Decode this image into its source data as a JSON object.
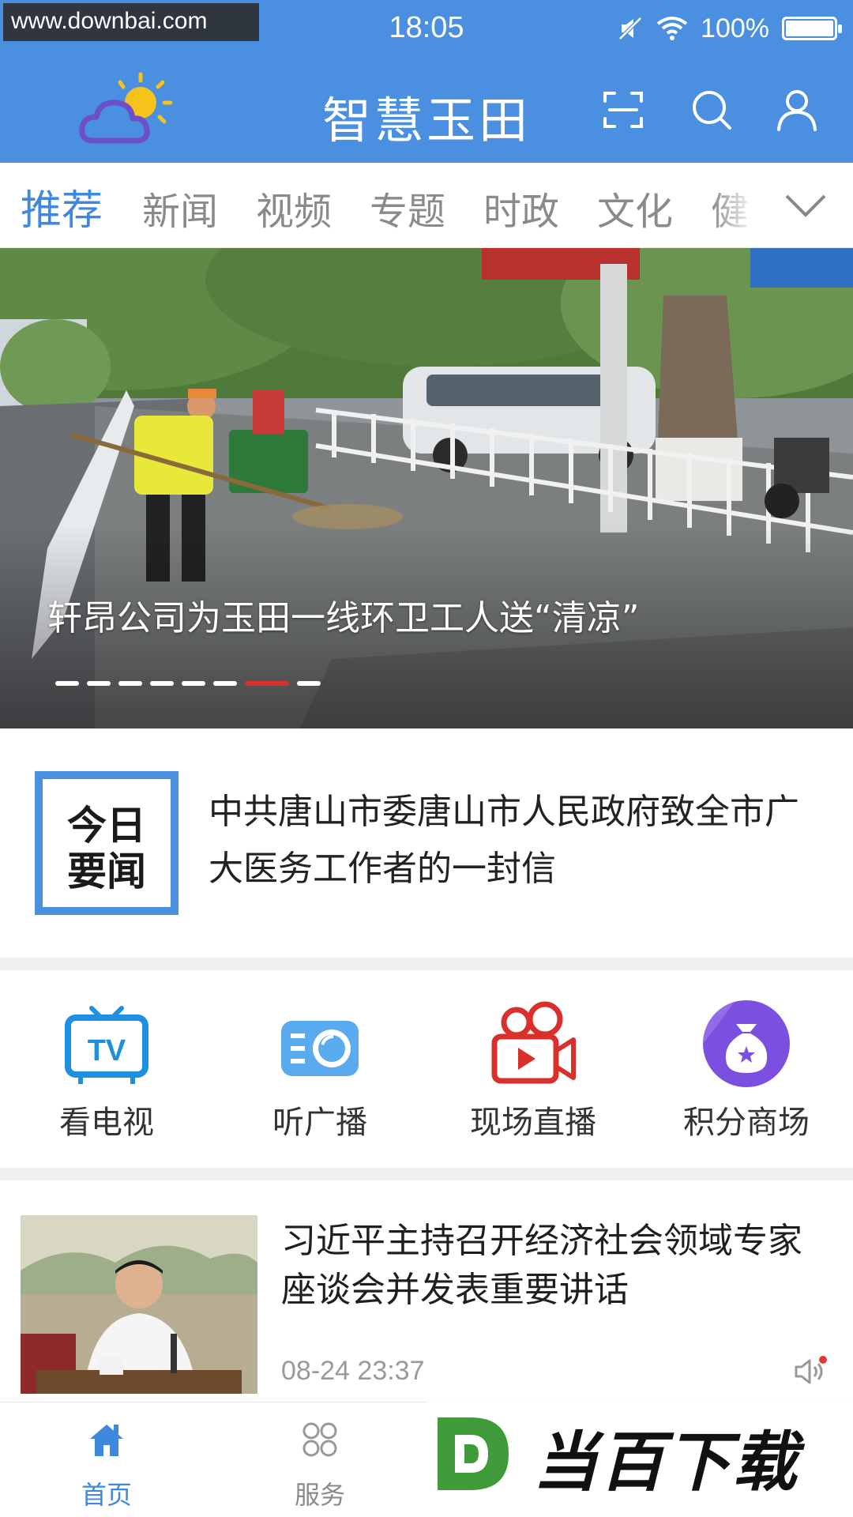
{
  "status_bar": {
    "watermark": "www.downbai.com",
    "time": "18:05",
    "battery": "100%"
  },
  "header": {
    "title": "智慧玉田"
  },
  "tabs": [
    {
      "label": "推荐",
      "active": true
    },
    {
      "label": "新闻",
      "active": false
    },
    {
      "label": "视频",
      "active": false
    },
    {
      "label": "专题",
      "active": false
    },
    {
      "label": "时政",
      "active": false
    },
    {
      "label": "文化",
      "active": false
    },
    {
      "label": "健",
      "active": false
    }
  ],
  "banner": {
    "title": "轩昂公司为玉田一线环卫工人送“清凉”",
    "slide_count": 8,
    "active_slide": 7
  },
  "headline": {
    "badge_line1": "今日",
    "badge_line2": "要闻",
    "text": "中共唐山市委唐山市人民政府致全市广大医务工作者的一封信"
  },
  "quick_links": [
    {
      "label": "看电视",
      "icon": "tv-icon"
    },
    {
      "label": "听广播",
      "icon": "radio-icon"
    },
    {
      "label": "现场直播",
      "icon": "video-camera-icon"
    },
    {
      "label": "积分商场",
      "icon": "money-bag-icon"
    }
  ],
  "news": [
    {
      "title": "习近平主持召开经济社会领域专家座谈会并发表重要讲话",
      "time": "08-24 23:37"
    }
  ],
  "bottom_nav": [
    {
      "label": "首页",
      "active": true
    },
    {
      "label": "服务",
      "active": false
    }
  ],
  "watermark_brand": {
    "text": "当百下载"
  },
  "colors": {
    "primary": "#4a8fe0",
    "tab_active": "#3f88de",
    "slide_active": "#d9302c",
    "live_red": "#d9302c",
    "points_purple": "#7b4fe0"
  }
}
